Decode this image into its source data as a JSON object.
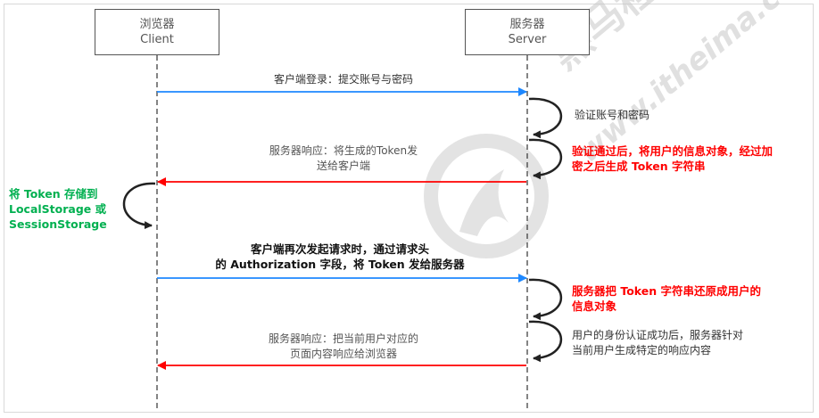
{
  "actors": {
    "client": {
      "name": "浏览器",
      "role": "Client"
    },
    "server": {
      "name": "服务器",
      "role": "Server"
    }
  },
  "messages": {
    "login": "客户端登录：提交账号与密码",
    "verify": "验证账号和密码",
    "respond_line1": "服务器响应：将生成的Token发",
    "respond_line2": "送给客户端",
    "generate_line1": "验证通过后，将用户的信息对象，经过加",
    "generate_line2": "密之后生成 Token 字符串",
    "store_line1": "将 Token 存储到",
    "store_line2": "LocalStorage 或",
    "store_line3": "SessionStorage",
    "request_line1": "客户端再次发起请求时，通过请求头",
    "request_line2": "的 Authorization 字段，将 Token 发给服务器",
    "restore_line1": "服务器把 Token 字符串还原成用户的",
    "restore_line2": "信息对象",
    "auth_line1": "用户的身份认证成功后，服务器针对",
    "auth_line2": "当前用户生成特定的响应内容",
    "final_line1": "服务器响应：把当前用户对应的",
    "final_line2": "页面内容响应给浏览器"
  },
  "watermark": {
    "brand": "黑马程序员",
    "url": "www.itheima.com"
  },
  "colors": {
    "request_arrow": "#1e88ff",
    "response_arrow": "#ff0000",
    "highlight_red": "#ff0000",
    "highlight_green": "#00b050",
    "lifeline": "#333333"
  }
}
